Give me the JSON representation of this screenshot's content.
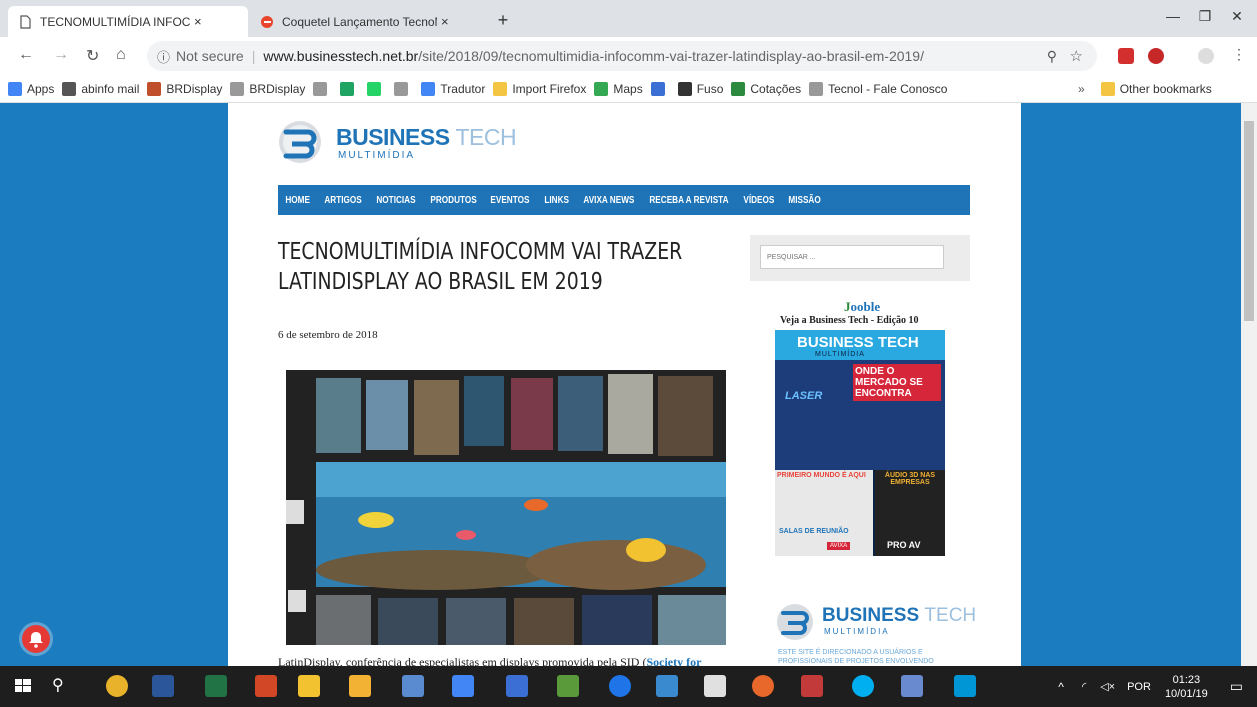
{
  "tabs": [
    {
      "title": "TECNOMULTIMÍDIA INFOCOMM",
      "close": "×"
    },
    {
      "title": "Coquetel Lançamento TecnoMult",
      "close": "×"
    }
  ],
  "new_tab": "+",
  "window_controls": {
    "minimize": "—",
    "restore": "❐",
    "close": "✕"
  },
  "address": {
    "not_secure": "Not secure",
    "separator": "|",
    "host": "www.businesstech.net.br",
    "path": "/site/2018/09/tecnomultimidia-infocomm-vai-trazer-latindisplay-ao-brasil-em-2019/"
  },
  "bookmarks": [
    {
      "label": "Apps",
      "icon": "apps-grid-icon",
      "color": "#4285f4"
    },
    {
      "label": "abinfo mail",
      "icon": "mail-icon",
      "color": "#555555"
    },
    {
      "label": "BRDisplay",
      "icon": "site-icon",
      "color": "#c0502b"
    },
    {
      "label": "BRDisplay",
      "icon": "page-icon",
      "color": "#999999"
    },
    {
      "label": "",
      "icon": "page-icon",
      "color": "#999999"
    },
    {
      "label": "",
      "icon": "drive-icon",
      "color": "#1fa463"
    },
    {
      "label": "",
      "icon": "whatsapp-icon",
      "color": "#25d366"
    },
    {
      "label": "",
      "icon": "page-icon",
      "color": "#999999"
    },
    {
      "label": "Tradutor",
      "icon": "translate-icon",
      "color": "#4285f4"
    },
    {
      "label": "Import Firefox",
      "icon": "folder-icon",
      "color": "#f4c542"
    },
    {
      "label": "Maps",
      "icon": "maps-icon",
      "color": "#34a853"
    },
    {
      "label": "",
      "icon": "calendar-icon",
      "color": "#3b6fd4"
    },
    {
      "label": "Fuso",
      "icon": "clock-icon",
      "color": "#333333"
    },
    {
      "label": "Cotações",
      "icon": "cd-icon",
      "color": "#2b8a3e"
    },
    {
      "label": "Tecnol - Fale Conosco",
      "icon": "page-icon",
      "color": "#999999"
    }
  ],
  "bookmarks_more": "»",
  "other_bookmarks": "Other bookmarks",
  "site": {
    "logo_main": "BUSINESS",
    "logo_accent": "TECH",
    "logo_sub": "MULTIMÍDIA",
    "menu": [
      "HOME",
      "ARTIGOS",
      "NOTICIAS",
      "PRODUTOS",
      "EVENTOS",
      "LINKS",
      "AVIXA NEWS",
      "RECEBA A REVISTA",
      "VÍDEOS",
      "MISSÃO"
    ],
    "article_title": "TECNOMULTIMÍDIA INFOCOMM VAI TRAZER LATINDISPLAY AO BRASIL EM 2019",
    "date": "6 de setembro de 2018",
    "body_start": "LatinDisplay, conferência de especialistas em displays promovida pela SID (",
    "body_link": "Society for",
    "search_placeholder": "PESQUISAR ...",
    "jooble_prefix": "J",
    "jooble_rest": "ooble",
    "magazine_caption": "Veja a Business Tech - Edição 10",
    "magazine": {
      "title": "BUSINESS TECH",
      "subtitle": "MULTIMÍDIA",
      "headline": "ONDE O MERCADO SE ENCONTRA",
      "laser": "LASER",
      "box1": "PRIMEIRO MUNDO É AQUI",
      "box2": "ÁUDIO 3D NAS EMPRESAS",
      "box3": "SALAS DE REUNIÃO",
      "badge": "PRO AV",
      "avixa": "AVIXA"
    },
    "side_desc": "ESTE SITE É DIRECIONADO A USUÁRIOS E PROFISSIONAIS DE PROJETOS ENVOLVENDO"
  },
  "tray": {
    "lang": "POR",
    "time": "01:23",
    "date": "10/01/19"
  }
}
